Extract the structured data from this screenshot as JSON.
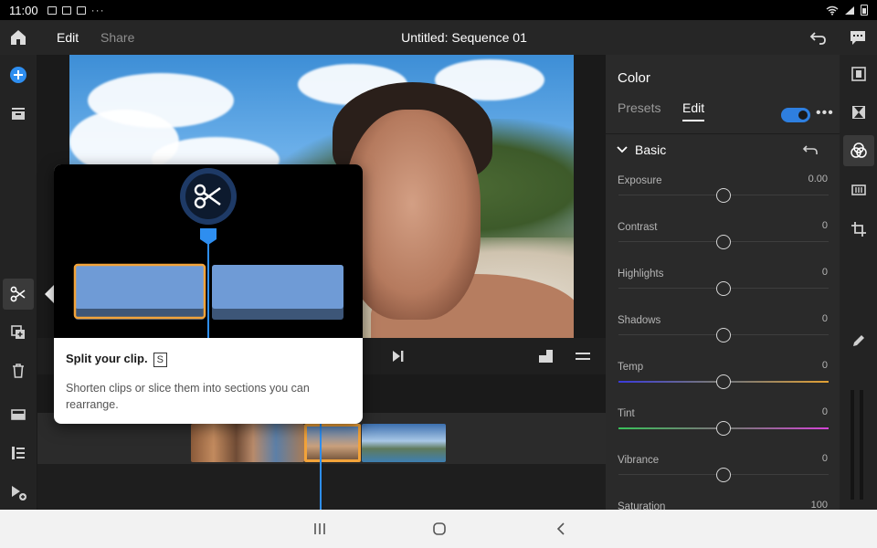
{
  "status_bar": {
    "time": "11:00",
    "more": "···"
  },
  "top_bar": {
    "tabs": [
      {
        "label": "Edit",
        "active": true
      },
      {
        "label": "Share",
        "active": false
      }
    ],
    "title": "Untitled: Sequence 01"
  },
  "left_toolbar": {
    "items": [
      {
        "name": "add",
        "icon": "plus-circle-icon"
      },
      {
        "name": "media",
        "icon": "inbox-tray-icon"
      },
      {
        "name": "split",
        "icon": "scissors-icon",
        "selected": true
      },
      {
        "name": "duplicate",
        "icon": "duplicate-icon"
      },
      {
        "name": "delete",
        "icon": "trash-icon"
      },
      {
        "name": "archive",
        "icon": "tray-icon"
      },
      {
        "name": "list",
        "icon": "list-icon"
      },
      {
        "name": "add-media",
        "icon": "add-media-icon"
      }
    ]
  },
  "tooltip": {
    "title": "Split your clip.",
    "shortcut": "S",
    "body": "Shorten clips or slice them into sections you can rearrange."
  },
  "color_panel": {
    "title": "Color",
    "tabs": [
      {
        "label": "Presets",
        "active": false
      },
      {
        "label": "Edit",
        "active": true
      }
    ],
    "enabled": true,
    "section": "Basic",
    "sliders": [
      {
        "label": "Exposure",
        "value": "0.00",
        "position": 0.5
      },
      {
        "label": "Contrast",
        "value": "0",
        "position": 0.5
      },
      {
        "label": "Highlights",
        "value": "0",
        "position": 0.5
      },
      {
        "label": "Shadows",
        "value": "0",
        "position": 0.5
      },
      {
        "label": "Temp",
        "value": "0",
        "position": 0.5
      },
      {
        "label": "Tint",
        "value": "0",
        "position": 0.5
      },
      {
        "label": "Vibrance",
        "value": "0",
        "position": 0.5
      },
      {
        "label": "Saturation",
        "value": "100",
        "position": 0.5
      }
    ]
  },
  "right_icons": [
    {
      "name": "clip-properties",
      "icon": "film-strip-icon"
    },
    {
      "name": "transitions",
      "icon": "hourglass-icon"
    },
    {
      "name": "color",
      "icon": "color-circles-icon",
      "selected": true
    },
    {
      "name": "audio",
      "icon": "equalizer-icon"
    },
    {
      "name": "crop",
      "icon": "crop-icon"
    },
    {
      "name": "draw",
      "icon": "pencil-icon"
    }
  ],
  "colors": {
    "accent": "#2e8ef0",
    "selection": "#f2a33a",
    "panel_bg": "#2a2a2a"
  }
}
